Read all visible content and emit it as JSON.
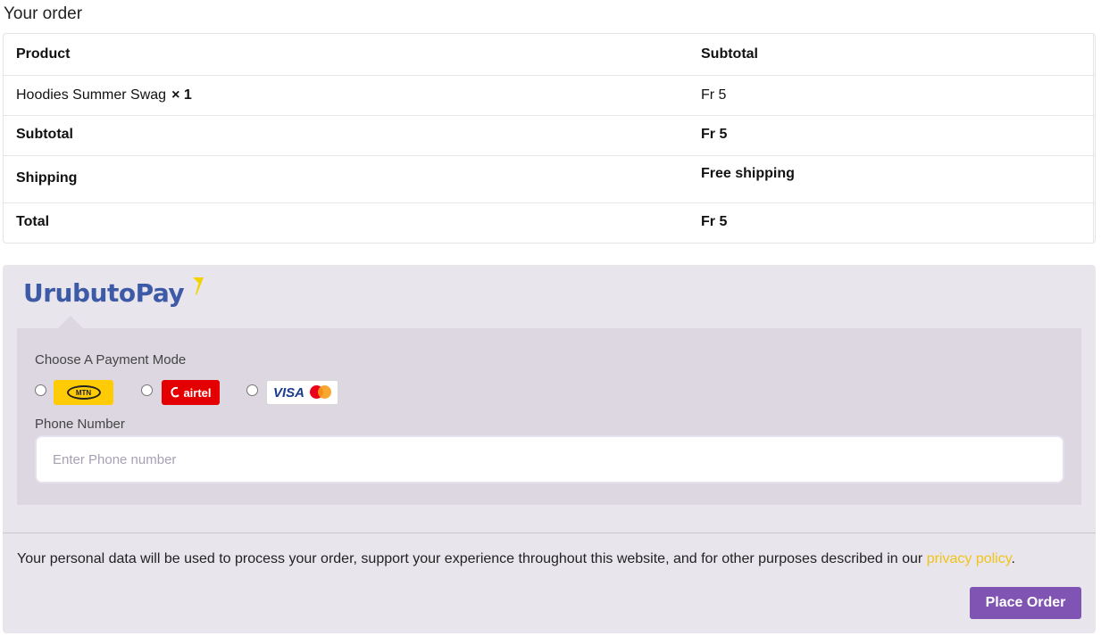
{
  "order": {
    "heading": "Your order",
    "col_product": "Product",
    "col_subtotal": "Subtotal",
    "item_name": "Hoodies Summer Swag",
    "item_qty": "× 1",
    "item_price": "Fr 5",
    "subtotal_label": "Subtotal",
    "subtotal_value": "Fr 5",
    "shipping_label": "Shipping",
    "shipping_value": "Free shipping",
    "total_label": "Total",
    "total_value": "Fr 5"
  },
  "payment": {
    "brand": "UrubutoPay",
    "brand_color": "#3d5aa7",
    "choose_label": "Choose A Payment Mode",
    "methods": [
      {
        "id": "mtn",
        "label": "MTN",
        "icon": "mtn-logo"
      },
      {
        "id": "airtel",
        "label": "airtel",
        "icon": "airtel-logo"
      },
      {
        "id": "card",
        "label": "VISA",
        "icon": "visa-mastercard-logo"
      }
    ],
    "phone_label": "Phone Number",
    "phone_placeholder": "Enter Phone number",
    "phone_value": ""
  },
  "privacy": {
    "text": "Your personal data will be used to process your order, support your experience throughout this website, and for other purposes described in our ",
    "link": "privacy policy",
    "end": "."
  },
  "actions": {
    "place_order": "Place Order",
    "accent": "#7f54b3"
  }
}
